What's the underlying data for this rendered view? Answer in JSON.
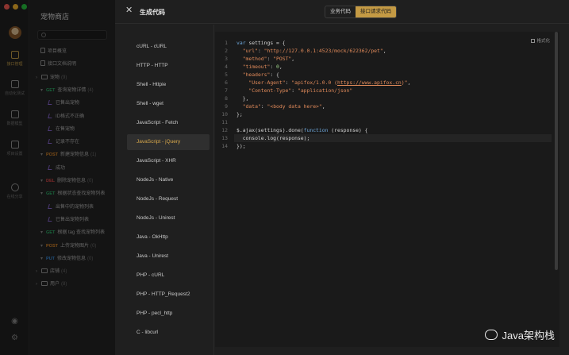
{
  "rail": {
    "items": [
      {
        "label": "接口管理",
        "active": true
      },
      {
        "label": "自动化测试",
        "active": false
      },
      {
        "label": "数据模型",
        "active": false
      },
      {
        "label": "项目设置",
        "active": false
      },
      {
        "label": "在线分享",
        "active": false
      }
    ]
  },
  "tree": {
    "project_title": "宠物商店",
    "rows": [
      {
        "type": "doc",
        "label": "项目概览"
      },
      {
        "type": "doc",
        "label": "接口文档说明"
      },
      {
        "type": "folder",
        "label": "宠物",
        "count": "(9)"
      },
      {
        "type": "api",
        "method": "GET",
        "label": "查询宠物详情",
        "count": "(4)"
      },
      {
        "type": "case",
        "label": "已售出宠物"
      },
      {
        "type": "case",
        "label": "ID格式不正确"
      },
      {
        "type": "case",
        "label": "在售宠物"
      },
      {
        "type": "case",
        "label": "记录不存在"
      },
      {
        "type": "api",
        "method": "POST",
        "label": "新建宠物信息",
        "count": "(1)"
      },
      {
        "type": "case",
        "label": "成功"
      },
      {
        "type": "api",
        "method": "DEL",
        "label": "删除宠物信息",
        "count": "(0)"
      },
      {
        "type": "api",
        "method": "GET",
        "label": "根据状态查找宠物列表"
      },
      {
        "type": "case",
        "label": "出售中的宠物列表"
      },
      {
        "type": "case",
        "label": "已售出宠物列表"
      },
      {
        "type": "api",
        "method": "GET",
        "label": "根据 tag 查找宠物列表"
      },
      {
        "type": "api",
        "method": "POST",
        "label": "上传宠物图片",
        "count": "(0)"
      },
      {
        "type": "api",
        "method": "PUT",
        "label": "修改宠物信息",
        "count": "(0)"
      },
      {
        "type": "folder",
        "label": "店铺",
        "count": "(4)"
      },
      {
        "type": "folder",
        "label": "用户",
        "count": "(8)"
      }
    ]
  },
  "drawer": {
    "close_icon": "close-icon",
    "title": "生成代码",
    "tabs": [
      {
        "label": "业务代码",
        "active": false
      },
      {
        "label": "接口请求代码",
        "active": true
      }
    ],
    "languages": [
      "cURL - cURL",
      "HTTP - HTTP",
      "Shell - Httpie",
      "Shell - wget",
      "JavaScript - Fetch",
      "JavaScript - jQuery",
      "JavaScript - XHR",
      "NodeJs - Native",
      "NodeJs - Request",
      "NodeJs - Unirest",
      "Java - OkHttp",
      "Java - Unirest",
      "PHP - cURL",
      "PHP - HTTP_Request2",
      "PHP - pecl_http",
      "C - libcurl"
    ],
    "selected_language": "JavaScript - jQuery",
    "format_label": "格式化",
    "code_lines": [
      "var settings = {",
      "  \"url\": \"http://127.0.0.1:4523/mock/622362/pet\",",
      "  \"method\": \"POST\",",
      "  \"timeout\": 0,",
      "  \"headers\": {",
      "    \"User-Agent\": \"apifox/1.0.0 (https://www.apifox.cn)\",",
      "    \"Content-Type\": \"application/json\"",
      "  },",
      "  \"data\": \"<body data here>\",",
      "};",
      "",
      "$.ajax(settings).done(function (response) {",
      "  console.log(response);",
      "});"
    ]
  },
  "watermark": "Java架构栈",
  "colors": {
    "accent": "#c49a44",
    "get": "#2fb36b",
    "post": "#e08a2a",
    "delete": "#e04b4b",
    "put": "#3a8fe0"
  }
}
